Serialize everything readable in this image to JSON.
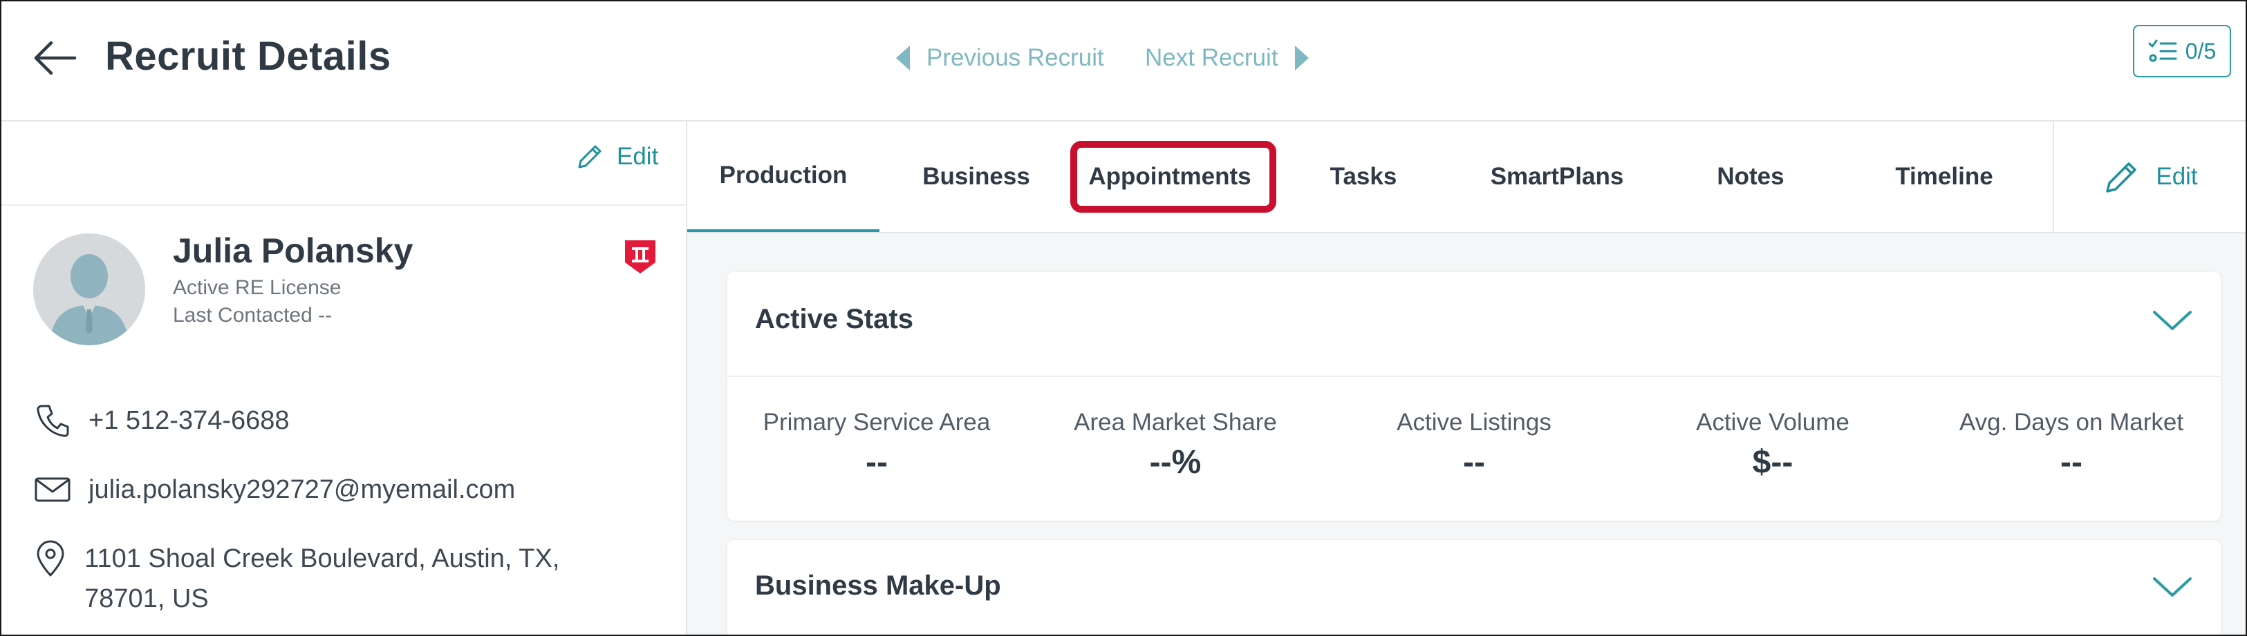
{
  "header": {
    "title": "Recruit Details",
    "prev_label": "Previous Recruit",
    "next_label": "Next Recruit",
    "checklist_count": "0/5"
  },
  "profile": {
    "edit_label": "Edit",
    "name": "Julia Polansky",
    "license": "Active RE License",
    "last_contacted": "Last Contacted --",
    "phone": "+1 512-374-6688",
    "email": "julia.polansky292727@myemail.com",
    "address": "1101 Shoal Creek Boulevard, Austin, TX, 78701, US"
  },
  "tabs": {
    "items": [
      {
        "label": "Production"
      },
      {
        "label": "Business"
      },
      {
        "label": "Appointments"
      },
      {
        "label": "Tasks"
      },
      {
        "label": "SmartPlans"
      },
      {
        "label": "Notes"
      },
      {
        "label": "Timeline"
      }
    ],
    "active": "Production",
    "highlighted": "Appointments",
    "edit_label": "Edit"
  },
  "active_stats": {
    "title": "Active Stats",
    "stats": [
      {
        "label": "Primary Service Area",
        "value": "--"
      },
      {
        "label": "Area Market Share",
        "value": "--%"
      },
      {
        "label": "Active Listings",
        "value": "--"
      },
      {
        "label": "Active Volume",
        "value": "$--"
      },
      {
        "label": "Avg. Days on Market",
        "value": "--"
      }
    ]
  },
  "business_makeup": {
    "title": "Business Make-Up"
  },
  "colors": {
    "accent": "#2a9aa6",
    "nav_muted": "#7fb8c2",
    "highlight": "#c8102e",
    "badge": "#e31b3b"
  },
  "icons": {
    "back": "arrow-left-icon",
    "checklist": "checklist-icon",
    "edit": "pencil-icon",
    "phone": "phone-icon",
    "email": "envelope-icon",
    "address": "map-pin-icon",
    "badge": "shield-badge-icon",
    "collapse": "chevron-down-icon"
  }
}
